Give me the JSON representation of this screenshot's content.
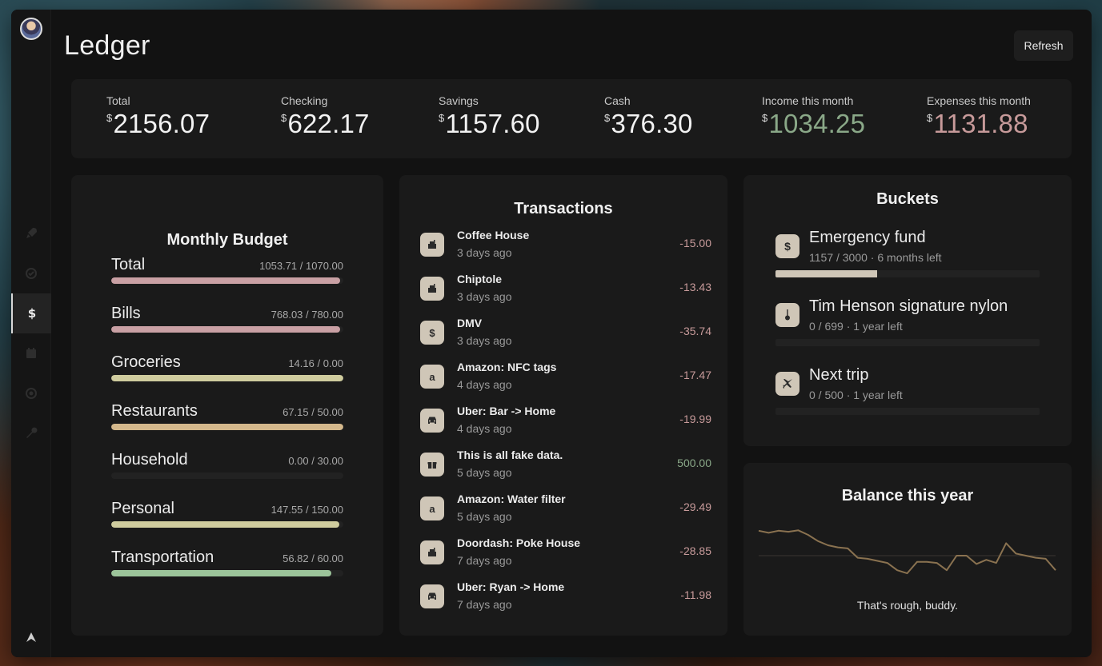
{
  "app": {
    "title": "Ledger",
    "refresh_label": "Refresh"
  },
  "sidebar": {
    "items": [
      {
        "icon": "rocket-icon"
      },
      {
        "icon": "check-circle-icon"
      },
      {
        "icon": "dollar-icon",
        "label": "$",
        "active": true
      },
      {
        "icon": "calendar-icon"
      },
      {
        "icon": "target-icon"
      },
      {
        "icon": "wrench-icon"
      }
    ],
    "bottom_icon": "arrow-up-logo-icon"
  },
  "summary": {
    "currency": "$",
    "stats": [
      {
        "label": "Total",
        "value": "2156.07"
      },
      {
        "label": "Checking",
        "value": "622.17"
      },
      {
        "label": "Savings",
        "value": "1157.60"
      },
      {
        "label": "Cash",
        "value": "376.30"
      },
      {
        "label": "Income this month",
        "value": "1034.25",
        "color": "#8aa888"
      },
      {
        "label": "Expenses this month",
        "value": "1131.88",
        "color": "#c79a9a"
      }
    ]
  },
  "budget": {
    "title": "Monthly Budget",
    "rows": [
      {
        "name": "Total",
        "amount": "1053.71 / 1070.00",
        "fill_pct": 98.5,
        "color": "#c9a0a4"
      },
      {
        "name": "Bills",
        "amount": "768.03 / 780.00",
        "fill_pct": 98.5,
        "color": "#c9a0a4"
      },
      {
        "name": "Groceries",
        "amount": "14.16 / 0.00",
        "fill_pct": 100,
        "color": "#cfcc9e"
      },
      {
        "name": "Restaurants",
        "amount": "67.15 / 50.00",
        "fill_pct": 100,
        "color": "#d4b88c"
      },
      {
        "name": "Household",
        "amount": "0.00 / 30.00",
        "fill_pct": 0,
        "color": "#cfcc9e"
      },
      {
        "name": "Personal",
        "amount": "147.55 / 150.00",
        "fill_pct": 98.3,
        "color": "#cfcc9e"
      },
      {
        "name": "Transportation",
        "amount": "56.82 / 60.00",
        "fill_pct": 94.7,
        "color": "#9cc49a"
      }
    ]
  },
  "transactions": {
    "title": "Transactions",
    "items": [
      {
        "icon": "food-icon",
        "name": "Coffee House",
        "when": "3 days ago",
        "amount": "-15.00"
      },
      {
        "icon": "food-icon",
        "name": "Chiptole",
        "when": "3 days ago",
        "amount": "-13.43"
      },
      {
        "icon": "dollar-icon",
        "glyph": "$",
        "name": "DMV",
        "when": "3 days ago",
        "amount": "-35.74"
      },
      {
        "icon": "amazon-icon",
        "glyph": "a",
        "name": "Amazon: NFC tags",
        "when": "4 days ago",
        "amount": "-17.47"
      },
      {
        "icon": "car-icon",
        "name": "Uber: Bar -> Home",
        "when": "4 days ago",
        "amount": "-19.99"
      },
      {
        "icon": "gift-icon",
        "name": "This is all fake data.",
        "when": "5 days ago",
        "amount": "500.00",
        "positive": true
      },
      {
        "icon": "amazon-icon",
        "glyph": "a",
        "name": "Amazon: Water filter",
        "when": "5 days ago",
        "amount": "-29.49"
      },
      {
        "icon": "food-icon",
        "name": "Doordash: Poke House",
        "when": "7 days ago",
        "amount": "-28.85"
      },
      {
        "icon": "car-icon",
        "name": "Uber: Ryan -> Home",
        "when": "7 days ago",
        "amount": "-11.98"
      }
    ]
  },
  "buckets": {
    "title": "Buckets",
    "items": [
      {
        "icon": "dollar-icon",
        "glyph": "$",
        "name": "Emergency fund",
        "sub": "1157 / 3000 · 6 months left",
        "fill_pct": 38.6
      },
      {
        "icon": "guitar-icon",
        "name": "Tim Henson signature nylon",
        "sub": "0 / 699 · 1 year left",
        "fill_pct": 0
      },
      {
        "icon": "plane-icon",
        "name": "Next trip",
        "sub": "0 / 500 · 1 year left",
        "fill_pct": 0
      }
    ]
  },
  "balance": {
    "title": "Balance this year",
    "caption": "That's rough, buddy.",
    "line_color": "#8a7250",
    "baseline_color": "#3a3632",
    "series": [
      12,
      11,
      12,
      11.5,
      12.2,
      10,
      7,
      5,
      4,
      3.5,
      -1,
      -1.5,
      -2.5,
      -3.5,
      -7,
      -8.5,
      -3,
      -3,
      -3.5,
      -7,
      0,
      0,
      -4,
      -2,
      -3.5,
      6,
      1,
      0,
      -1,
      -1.5,
      -7
    ]
  }
}
